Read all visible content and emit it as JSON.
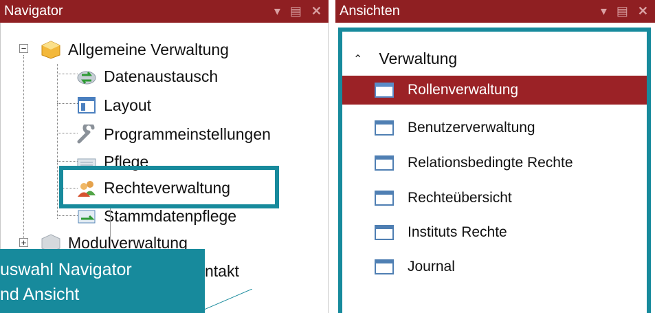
{
  "navigator": {
    "title": "Navigator",
    "header_icons": [
      "dropdown-arrow-icon",
      "pin-icon",
      "close-icon"
    ],
    "items": [
      {
        "label": "Allgemeine Verwaltung",
        "icon": "package-icon",
        "expanded": true
      },
      {
        "label": "Datenaustausch",
        "icon": "exchange-icon"
      },
      {
        "label": "Layout",
        "icon": "layout-icon"
      },
      {
        "label": "Programmeinstellungen",
        "icon": "wrench-icon"
      },
      {
        "label": "Pflege",
        "icon": "keyboard-icon"
      },
      {
        "label": "Rechteverwaltung",
        "icon": "users-icon",
        "highlighted": true
      },
      {
        "label": "Stammdatenpflege",
        "icon": "data-icon"
      },
      {
        "label": "Modulverwaltung",
        "icon": "module-icon",
        "expanded": false
      },
      {
        "label": "Kontakt",
        "icon": "contact-icon"
      }
    ]
  },
  "views": {
    "title": "Ansichten",
    "group": "Verwaltung",
    "items": [
      {
        "label": "Rollenverwaltung",
        "selected": true
      },
      {
        "label": "Benutzerverwaltung"
      },
      {
        "label": "Relationsbedingte Rechte"
      },
      {
        "label": "Rechteübersicht"
      },
      {
        "label": "Instituts Rechte"
      },
      {
        "label": "Journal"
      }
    ]
  },
  "callout": {
    "line1": "uswahl Navigator",
    "line2": "nd Ansicht",
    "partial_text": "ntakt"
  },
  "colors": {
    "header_bg": "#8f1f22",
    "selection_bg": "#9b2226",
    "highlight": "#178a9c"
  }
}
